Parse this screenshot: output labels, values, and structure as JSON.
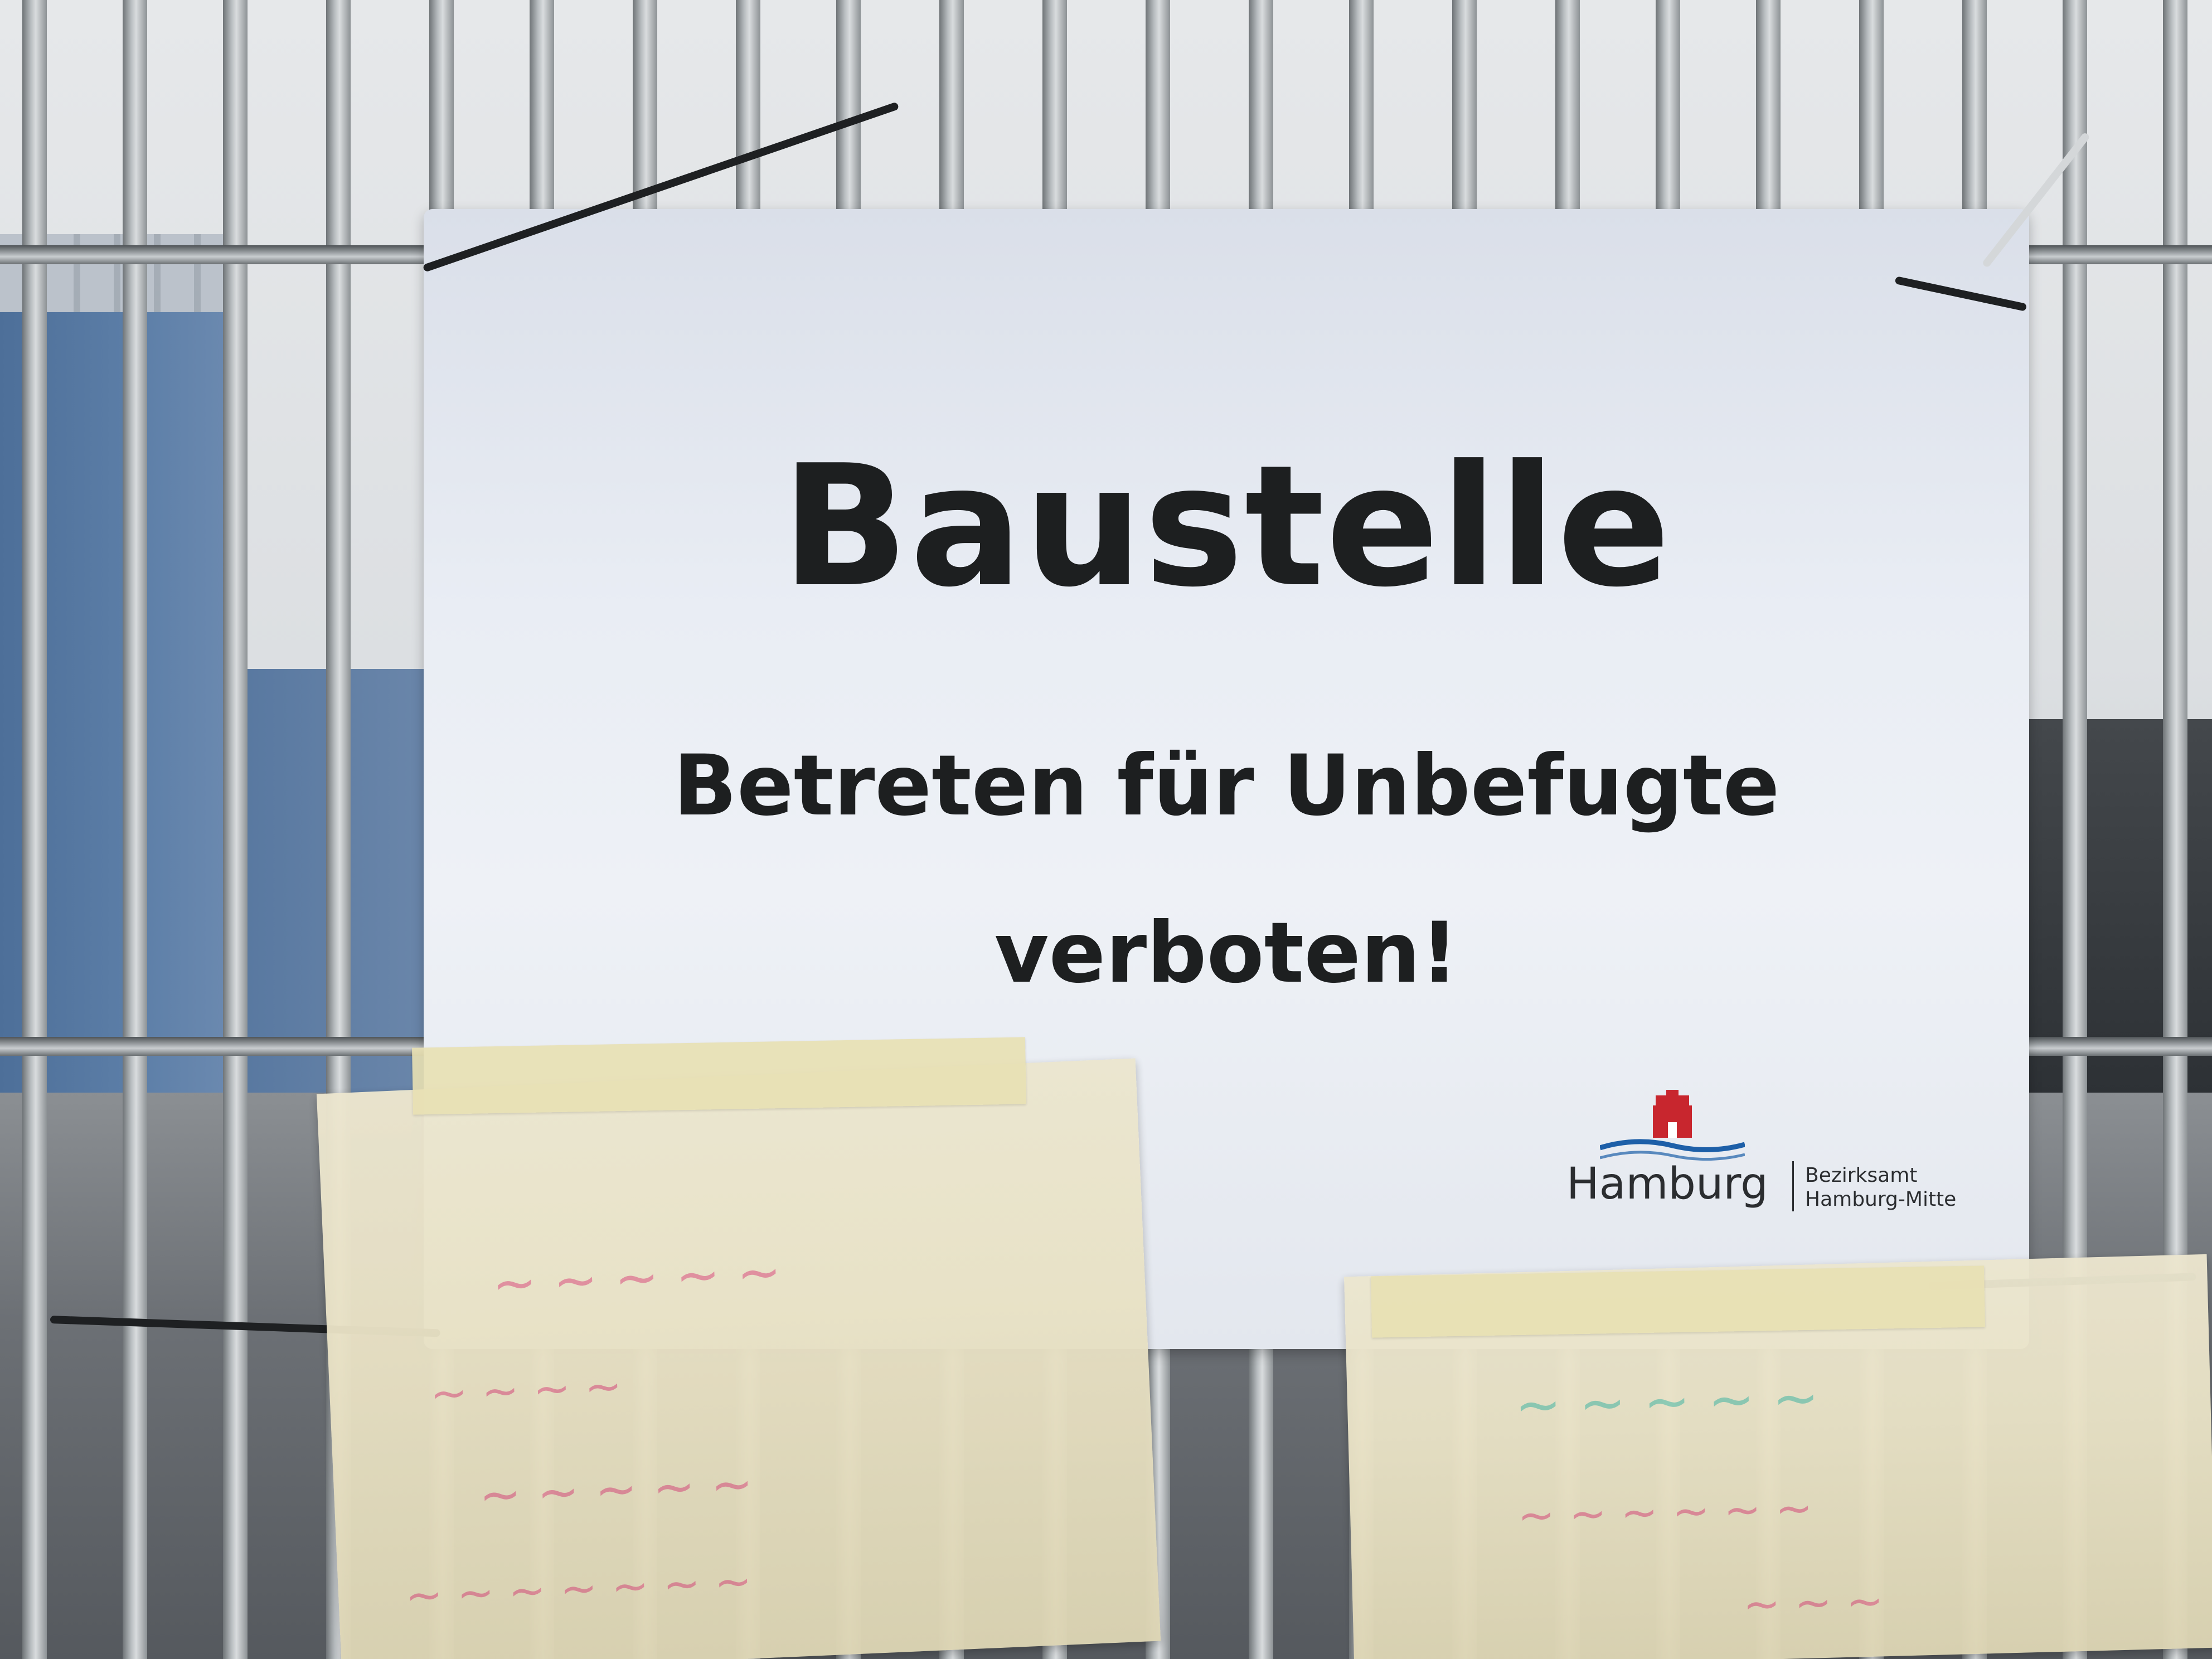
{
  "sign": {
    "title": "Baustelle",
    "line1": "Betreten für Unbefugte",
    "line2": "verboten!"
  },
  "logo": {
    "name": "Hamburg",
    "department_line1": "Bezirksamt",
    "department_line2": "Hamburg-Mitte"
  },
  "colors": {
    "sign_text": "#1d1f20",
    "logo_red": "#c8262e",
    "logo_blue": "#1d5fa8",
    "note_red_ink": "#d8487a",
    "note_teal_ink": "#41b8a5"
  }
}
